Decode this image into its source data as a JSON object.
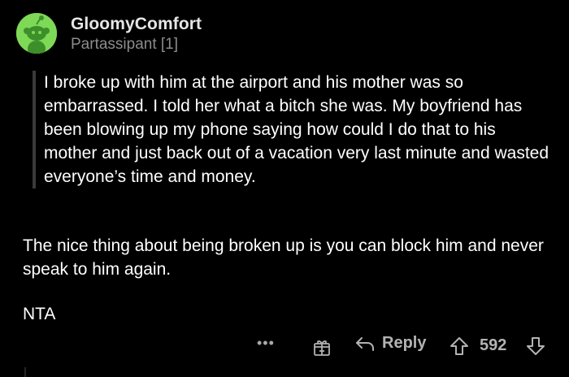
{
  "comment": {
    "username": "GloomyComfort",
    "flair": "Partassipant [1]",
    "quote": "I broke up with him at the airport and his mother was so embarrassed. I told her what a bitch she was. My boyfriend has been blowing up my phone saying how could I do that to his mother and just back out of a vacation very last minute and wasted everyone’s time and money.",
    "paragraphs": [
      "The nice thing about being broken up is you can block him and never speak to him again.",
      "NTA"
    ]
  },
  "actions": {
    "more_label": "•••",
    "reply_label": "Reply",
    "score": "592"
  },
  "colors": {
    "background": "#000000",
    "avatar_bg": "#7ed957",
    "text": "#ffffff",
    "muted": "#8c8c8c"
  },
  "icons": [
    "snoo-avatar-icon",
    "award-gift-icon",
    "reply-arrow-icon",
    "upvote-arrow-icon",
    "downvote-arrow-icon"
  ]
}
